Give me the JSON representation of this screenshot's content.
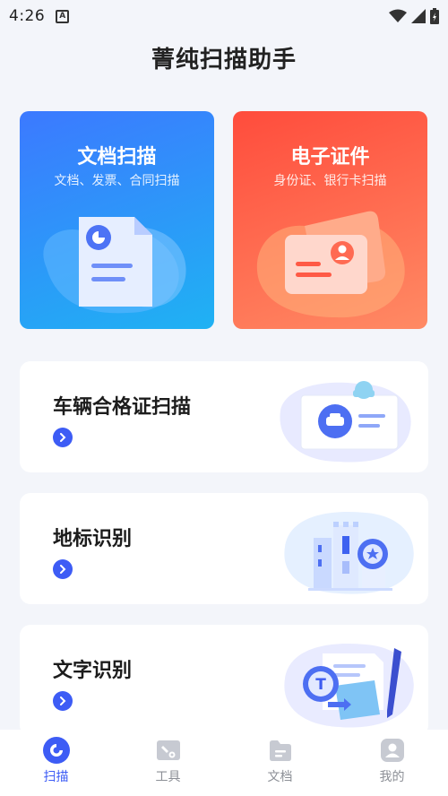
{
  "status_bar": {
    "time": "4:26"
  },
  "app": {
    "title": "菁纯扫描助手"
  },
  "cards": {
    "doc_scan": {
      "title": "文档扫描",
      "subtitle": "文档、发票、合同扫描"
    },
    "id_scan": {
      "title": "电子证件",
      "subtitle": "身份证、银行卡扫描"
    }
  },
  "features": [
    {
      "label": "车辆合格证扫描"
    },
    {
      "label": "地标识别"
    },
    {
      "label": "文字识别"
    }
  ],
  "tabs": [
    {
      "label": "扫描",
      "active": true
    },
    {
      "label": "工具",
      "active": false
    },
    {
      "label": "文档",
      "active": false
    },
    {
      "label": "我的",
      "active": false
    }
  ],
  "colors": {
    "accent": "#3d5cf5",
    "doc_card": "#3c79ff",
    "id_card": "#ff4c3c",
    "inactive": "#8c8f96"
  }
}
